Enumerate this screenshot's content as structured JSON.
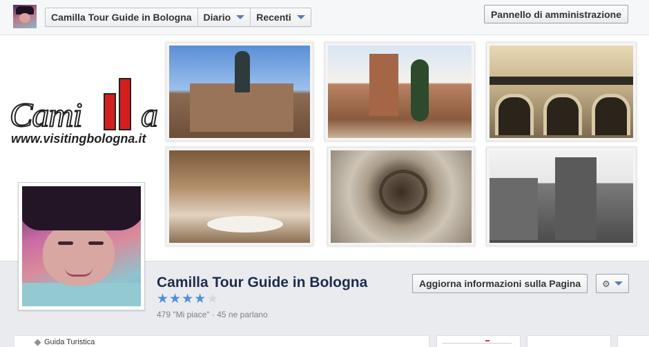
{
  "header": {
    "page_name_crumb": "Camilla Tour Guide in Bologna",
    "diario_label": "Diario",
    "recenti_label": "Recenti",
    "admin_panel_label": "Pannello di amministrazione"
  },
  "cover": {
    "logo_text": "Cami",
    "logo_tail": "a",
    "logo_url": "www.visitingbologna.it",
    "photos": [
      {
        "name": "neptune-fountain"
      },
      {
        "name": "santo-stefano"
      },
      {
        "name": "theater-facade"
      },
      {
        "name": "anatomical-theater"
      },
      {
        "name": "ancient-well"
      },
      {
        "name": "medieval-tower"
      }
    ]
  },
  "page": {
    "title": "Camilla Tour Guide in Bologna",
    "rating": 4,
    "rating_max": 5,
    "likes_text": "479 \"Mi piace\" · 45 ne parlano",
    "update_button_label": "Aggiorna informazioni sulla Pagina",
    "settings_icon": "gear-icon"
  },
  "bottom": {
    "category_label": "Guida Turistica"
  },
  "colors": {
    "title": "#1d2c4c",
    "star_filled": "#4f8fd8",
    "star_empty": "#d6d8dc",
    "caret": "#5b7bb1",
    "logo_red": "#d41f1f"
  }
}
